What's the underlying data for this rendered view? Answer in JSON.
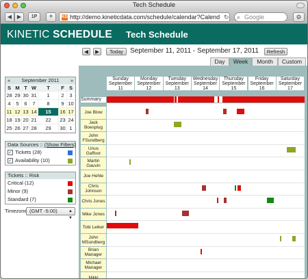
{
  "browser": {
    "window_title": "Tech Schedule",
    "url": "http://demo.kineticdata.com/schedule/calendar?Calend",
    "search_placeholder": "Google",
    "one_password_label": "1P",
    "new_tab_label": "+",
    "favicon_label": "KD"
  },
  "header": {
    "brand_light": "KINETIC ",
    "brand_bold": "SCHEDULE",
    "title": "Tech Schedule"
  },
  "datenav": {
    "today_label": "Today",
    "range": "September 11, 2011 - September 17, 2011",
    "refresh_label": "Refresh"
  },
  "view_tabs": [
    "Day",
    "Week",
    "Month",
    "Custom"
  ],
  "active_tab": "Week",
  "minical": {
    "month": "September 2011",
    "prev": "«",
    "next": "»",
    "dow": [
      "S",
      "M",
      "T",
      "W",
      "T",
      "F",
      "S"
    ],
    "weeks": [
      [
        "28",
        "29",
        "30",
        "31",
        "1",
        "2",
        "3"
      ],
      [
        "4",
        "5",
        "6",
        "7",
        "8",
        "9",
        "10"
      ],
      [
        "11",
        "12",
        "13",
        "14",
        "15",
        "16",
        "17"
      ],
      [
        "18",
        "19",
        "20",
        "21",
        "22",
        "23",
        "24"
      ],
      [
        "25",
        "26",
        "27",
        "28",
        "29",
        "30",
        "1"
      ]
    ],
    "today": "15"
  },
  "data_sources": {
    "title": "Data Sources :: ",
    "show_filters": "(Show Filters)",
    "items": [
      {
        "label": "Tickets (28)",
        "color": "#2f6fe0"
      },
      {
        "label": "Availability (10)",
        "color": "#8fa628"
      }
    ]
  },
  "risk": {
    "title": "Tickets :: Risk",
    "items": [
      {
        "label": "Critical (12)",
        "color": "#e30a0a"
      },
      {
        "label": "Minor (9)",
        "color": "#a63232"
      },
      {
        "label": "Standard (7)",
        "color": "#118a11"
      }
    ]
  },
  "timezone": {
    "label": "Timezone:",
    "value": "(GMT -5:00)"
  },
  "schedule": {
    "summary_label": "Summary",
    "days": [
      {
        "name": "Sunday",
        "month": "September",
        "day": "11"
      },
      {
        "name": "Monday",
        "month": "September",
        "day": "12"
      },
      {
        "name": "Tuesday",
        "month": "September",
        "day": "13"
      },
      {
        "name": "Wednesday",
        "month": "September",
        "day": "14"
      },
      {
        "name": "Thursday",
        "month": "September",
        "day": "15"
      },
      {
        "name": "Friday",
        "month": "September",
        "day": "16"
      },
      {
        "name": "Saturday",
        "month": "September",
        "day": "17"
      }
    ],
    "people": [
      "Joe Blow",
      "Jack Boesplug",
      "John FSundberg",
      "Unus Gaffoor",
      "Martin Gauvin",
      "Joe Hehle",
      "Chris Johnson",
      "Chris Jones",
      "Mike Jones",
      "Tobi Leiker",
      "John MSundberg",
      "Brian Manager",
      "Michael Manager",
      "Nikki"
    ]
  }
}
